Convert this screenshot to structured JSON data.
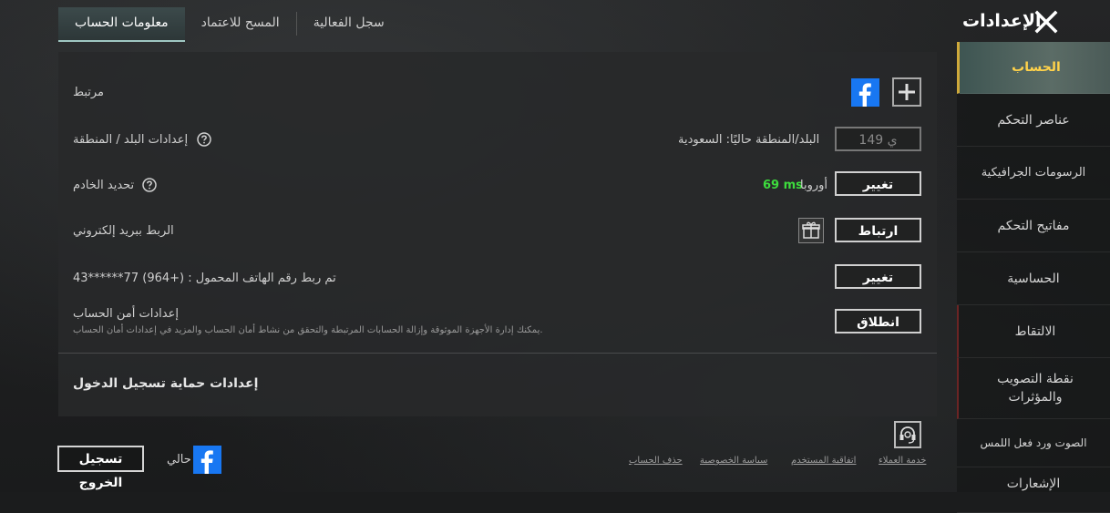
{
  "header": {
    "title": "الإعدادات"
  },
  "tabs": [
    {
      "label": "معلومات الحساب"
    },
    {
      "label": "المسح للاعتماد"
    },
    {
      "label": "سجل الفعالية"
    }
  ],
  "sidebar": {
    "items": [
      {
        "label": "الحساب"
      },
      {
        "label": "عناصر التحكم"
      },
      {
        "label": "الرسومات الجرافيكية"
      },
      {
        "label": "مفاتيح التحكم"
      },
      {
        "label": "الحساسية"
      },
      {
        "label": "الالتقاط"
      },
      {
        "label": "نقطة التصويب والمؤثرات"
      },
      {
        "label": "الصوت ورد فعل اللمس"
      },
      {
        "label": "الإشعارات"
      }
    ]
  },
  "account": {
    "linked_label": "مرتبط",
    "region_label": "إعدادات البلد / المنطقة",
    "region_current": "البلد/المنطقة حاليًا: السعودية",
    "region_button": "149 ي",
    "server_label": "تحديد الخادم",
    "server_name": "أوروبا",
    "server_ping": "69 ms",
    "server_button": "تغيير",
    "email_label": "الربط ببريد إلكتروني",
    "email_button": "ارتباط",
    "phone_text": "تم ربط رقم الهاتف المحمول : (+964) 77******43",
    "phone_button": "تغيير",
    "security_title": "إعدادات أمن الحساب",
    "security_desc": "يمكنك إدارة الأجهزة الموثوقة وإزالة الحسابات المرتبطة والتحقق من نشاط أمان الحساب والمزيد في إعدادات أمان الحساب.",
    "security_button": "انطلاق",
    "login_protection_title": "إعدادات حماية تسجيل الدخول"
  },
  "footer": {
    "logout": "تسجيل الخروج",
    "current_label": "حالي",
    "customer_service": "خدمة العملاء",
    "user_agreement": "اتفاقية المستخدم",
    "privacy_policy": "سياسة الخصوصية",
    "delete_account": "حذف الحساب"
  },
  "colors": {
    "accent_gold": "#ffd24a",
    "ping_green": "#3ddc3d",
    "facebook_blue": "#1877f2"
  },
  "icons": [
    "close-icon",
    "facebook-icon",
    "plus-icon",
    "help-icon",
    "gift-icon",
    "headset-icon"
  ]
}
